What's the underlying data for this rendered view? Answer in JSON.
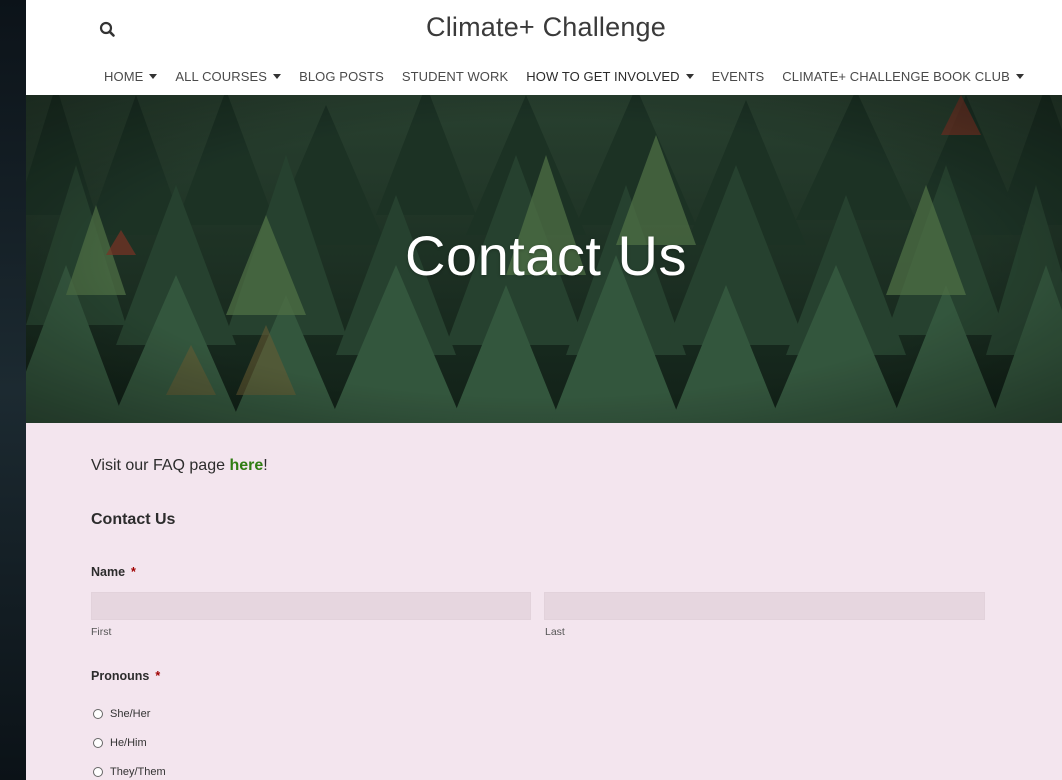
{
  "header": {
    "site_title": "Climate+ Challenge",
    "nav": [
      {
        "label": "HOME",
        "dropdown": true
      },
      {
        "label": "ALL COURSES",
        "dropdown": true
      },
      {
        "label": "BLOG POSTS",
        "dropdown": false
      },
      {
        "label": "STUDENT WORK",
        "dropdown": false
      },
      {
        "label": "HOW TO GET INVOLVED",
        "dropdown": true
      },
      {
        "label": "EVENTS",
        "dropdown": false
      },
      {
        "label": "CLIMATE+ CHALLENGE BOOK CLUB",
        "dropdown": true
      }
    ]
  },
  "hero": {
    "title": "Contact Us"
  },
  "content": {
    "faq_prefix": "Visit our FAQ page ",
    "faq_link": "here",
    "faq_suffix": "!",
    "form_title": "Contact Us",
    "name_label": "Name",
    "required_mark": "*",
    "first_sublabel": "First",
    "last_sublabel": "Last",
    "first_value": "",
    "last_value": "",
    "pronouns_label": "Pronouns",
    "pronoun_options": [
      "She/Her",
      "He/Him",
      "They/Them"
    ]
  },
  "colors": {
    "page_background": "#f3e5ee",
    "input_background": "#e6d6df",
    "link": "#2f7d12",
    "required": "#a00000"
  }
}
